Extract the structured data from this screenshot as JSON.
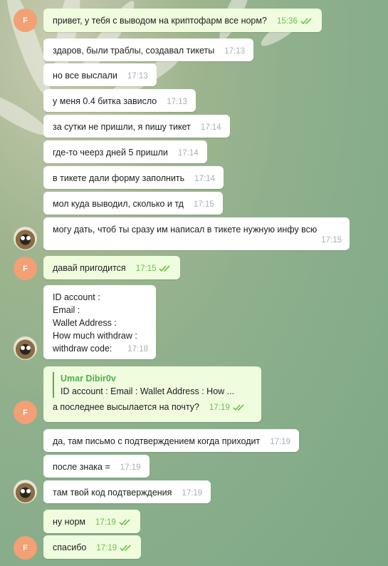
{
  "colors": {
    "outgoing_bubble": "#effdde",
    "incoming_bubble": "#ffffff",
    "avatar_f": "#f2a074",
    "check": "#6cbf4b"
  },
  "avatars": {
    "f_initial": "F"
  },
  "messages": [
    {
      "text": "привет, у тебя с выводом на криптофарм все норм?",
      "time": "15:36",
      "dir": "out",
      "read": true
    },
    {
      "text": "здаров, были траблы, создавал тикеты",
      "time": "17:13",
      "dir": "in"
    },
    {
      "text": "но все выслали",
      "time": "17:13",
      "dir": "in"
    },
    {
      "text": "у меня 0.4 битка зависло",
      "time": "17:13",
      "dir": "in"
    },
    {
      "text": "за сутки не пришли, я пишу тикет",
      "time": "17:14",
      "dir": "in"
    },
    {
      "text": "где-то чеерз дней 5 пришли",
      "time": "17:14",
      "dir": "in"
    },
    {
      "text": "в тикете дали форму заполнить",
      "time": "17:14",
      "dir": "in"
    },
    {
      "text": "мол куда выводил, сколько и тд",
      "time": "17:15",
      "dir": "in"
    },
    {
      "text": "могу дать, чтоб ты сразу им написал в тикете нужную инфу всю",
      "time": "17:15",
      "dir": "in"
    },
    {
      "text": "давай пригодится",
      "time": "17:15",
      "dir": "out",
      "read": true
    },
    {
      "text": "ID account :\nEmail :\nWallet Address :\nHow much withdraw :\nwithdraw code:",
      "time": "17:18",
      "dir": "in"
    },
    {
      "text": "а последнее высылается на почту?",
      "time": "17:19",
      "dir": "out",
      "read": true,
      "reply": {
        "name": "Umar Dibir0v",
        "text": "ID account :  Email :  Wallet Address :  How ..."
      }
    },
    {
      "text": "да, там письмо с подтверждением когда приходит",
      "time": "17:19",
      "dir": "in"
    },
    {
      "text": "после знака =",
      "time": "17:19",
      "dir": "in"
    },
    {
      "text": "там твой код подтверждения",
      "time": "17:19",
      "dir": "in"
    },
    {
      "text": "ну норм",
      "time": "17:19",
      "dir": "out",
      "read": true
    },
    {
      "text": "спасибо",
      "time": "17:19",
      "dir": "out",
      "read": true
    }
  ]
}
